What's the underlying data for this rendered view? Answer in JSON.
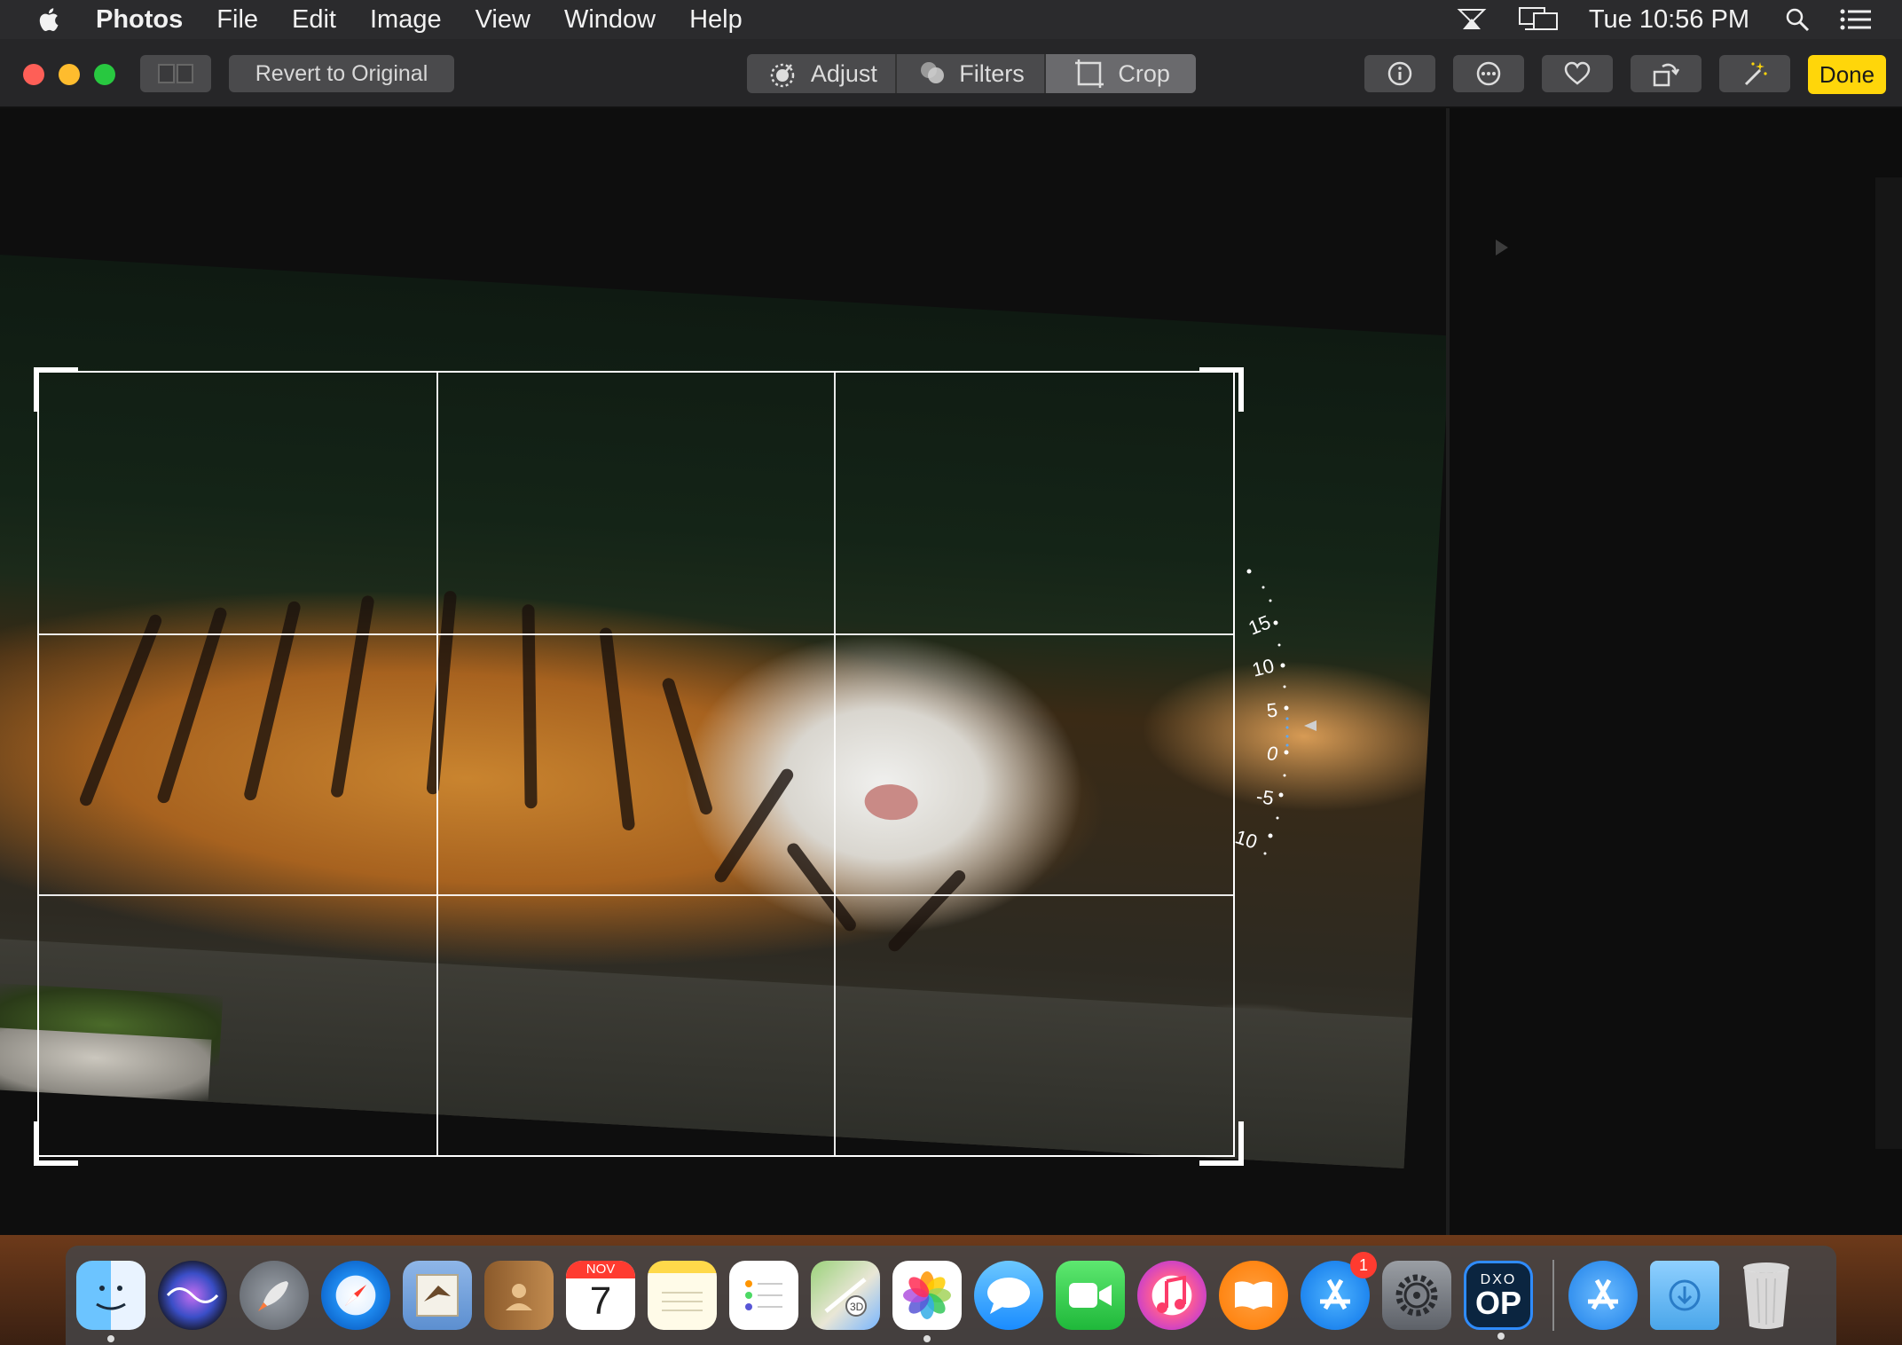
{
  "menubar": {
    "app_name": "Photos",
    "menus": [
      "File",
      "Edit",
      "Image",
      "View",
      "Window",
      "Help"
    ],
    "clock": "Tue 10:56 PM",
    "status_icons": [
      "airplay-icon",
      "display-mirroring-icon",
      "spotlight-search-icon",
      "notification-center-icon"
    ]
  },
  "toolbar": {
    "revert_label": "Revert to Original",
    "tabs": [
      "Adjust",
      "Filters",
      "Crop"
    ],
    "active_tab": "Crop",
    "right_icons": [
      "info-icon",
      "more-options-icon",
      "favorite-heart-icon",
      "rotate-icon",
      "auto-enhance-wand-icon"
    ],
    "done_label": "Done"
  },
  "straighten_dial": {
    "ticks": [
      "15",
      "10",
      "5",
      "0",
      "-5",
      "10"
    ],
    "current_value": 3
  },
  "dock": {
    "apps": [
      "Finder",
      "Siri",
      "Launchpad",
      "Safari",
      "Mail",
      "Contacts",
      "Calendar",
      "Notes",
      "Reminders",
      "Maps",
      "Photos",
      "Messages",
      "FaceTime",
      "iTunes",
      "iBooks",
      "App Store",
      "System Preferences",
      "DxO OpticsPro"
    ],
    "calendar_month": "NOV",
    "calendar_day": "7",
    "app_store_badge": "1",
    "dxo_top": "DXO",
    "dxo_bottom": "OP",
    "right_items": [
      "App Store Downloads",
      "Downloads",
      "Trash"
    ]
  },
  "colors": {
    "done_button": "#ffd60a",
    "traffic_close": "#fe5f57",
    "traffic_minimize": "#febc2e",
    "traffic_zoom": "#28c840"
  }
}
